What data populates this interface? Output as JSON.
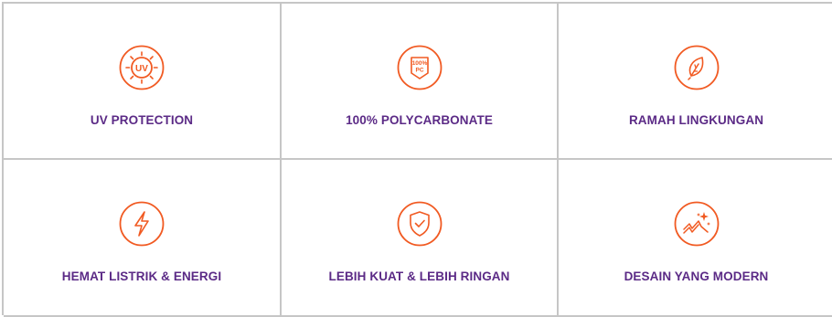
{
  "accent_color": "#f15a22",
  "label_color": "#5b2a86",
  "features": [
    {
      "icon": "uv-sun-icon",
      "icon_text": "UV",
      "label": "UV PROTECTION"
    },
    {
      "icon": "polycarbonate-badge-icon",
      "icon_text_top": "100%",
      "icon_text_bottom": "PC",
      "label": "100% POLYCARBONATE"
    },
    {
      "icon": "leaf-icon",
      "label": "RAMAH LINGKUNGAN"
    },
    {
      "icon": "lightning-bolt-icon",
      "label": "HEMAT LISTRIK & ENERGI"
    },
    {
      "icon": "shield-check-icon",
      "label": "LEBIH KUAT & LEBIH RINGAN"
    },
    {
      "icon": "modern-design-sparkle-icon",
      "label": "DESAIN YANG MODERN"
    }
  ]
}
